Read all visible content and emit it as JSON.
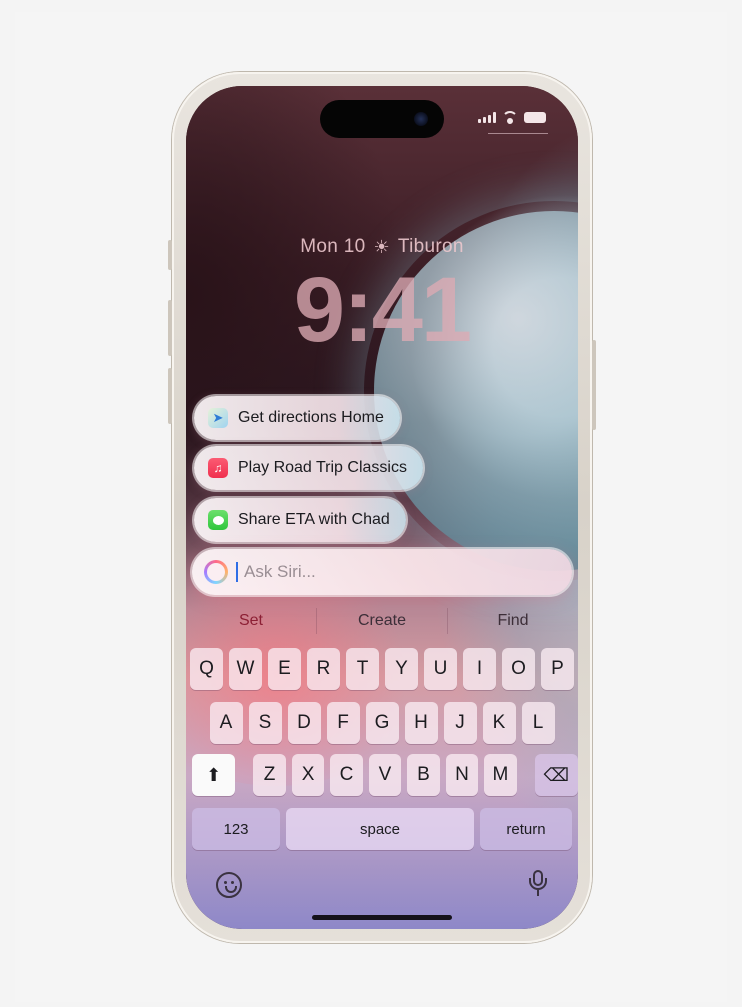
{
  "lock_screen": {
    "date": "Mon 10",
    "weather_icon": "sun-icon",
    "location": "Tiburon",
    "time": "9:41"
  },
  "status_bar": {
    "icons": [
      "cellular-signal-icon",
      "wifi-icon",
      "battery-icon"
    ]
  },
  "siri": {
    "suggestions": [
      {
        "label": "Get directions Home",
        "icon": "maps-app-icon"
      },
      {
        "label": "Play Road Trip Classics",
        "icon": "music-app-icon"
      },
      {
        "label": "Share ETA with Chad",
        "icon": "messages-app-icon"
      }
    ],
    "input_placeholder": "Ask Siri..."
  },
  "predictive_text": [
    "Set",
    "Create",
    "Find"
  ],
  "keyboard": {
    "row1": [
      "Q",
      "W",
      "E",
      "R",
      "T",
      "Y",
      "U",
      "I",
      "O",
      "P"
    ],
    "row2": [
      "A",
      "S",
      "D",
      "F",
      "G",
      "H",
      "J",
      "K",
      "L"
    ],
    "row3": [
      "Z",
      "X",
      "C",
      "V",
      "B",
      "N",
      "M"
    ],
    "shift_glyph": "⬆",
    "delete_glyph": "⌫",
    "numbers_label": "123",
    "space_label": "space",
    "return_label": "return",
    "emoji_icon": "emoji-icon",
    "mic_icon": "microphone-icon"
  },
  "colors": {
    "accent_caret": "#2f6ee6",
    "predict_highlight": "#8c1f34"
  }
}
